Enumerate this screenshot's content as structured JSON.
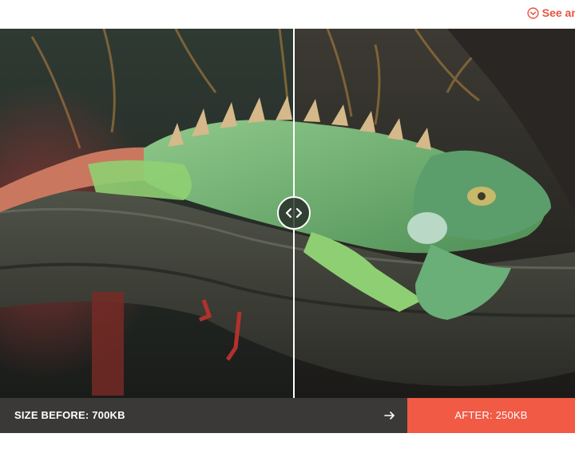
{
  "header": {
    "link_label": "See any di",
    "link_icon": "chevron-circle-down-icon"
  },
  "comparison": {
    "image_subject": "iguana on branch",
    "handle_icon": "left-right-arrows-icon",
    "slider_position": 0.51
  },
  "footer": {
    "before_label": "SIZE BEFORE: 700KB",
    "arrow_icon": "arrow-right-icon",
    "after_label": "AFTER: 250KB"
  },
  "colors": {
    "accent": "#f15a45",
    "link": "#e8533f",
    "before_bg": "#3a3938",
    "text": "#ffffff"
  }
}
